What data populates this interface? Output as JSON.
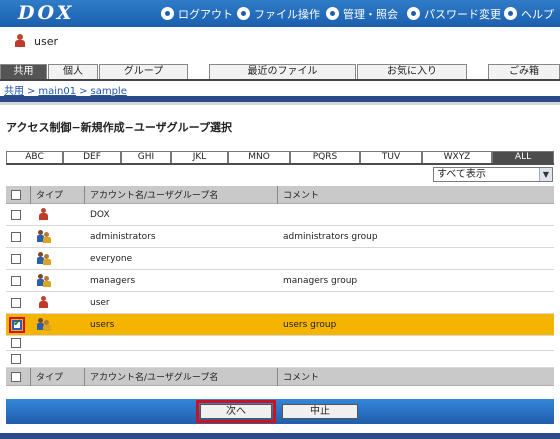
{
  "app": {
    "logo": "DOX"
  },
  "nav": {
    "logout": "ログアウト",
    "file_ops": "ファイル操作",
    "admin": "管理・照会",
    "password": "パスワード変更",
    "help": "ヘルプ"
  },
  "user": {
    "name": "user"
  },
  "tabs": {
    "shared": "共用",
    "personal": "個人",
    "group": "グループ",
    "recent": "最近のファイル",
    "favorites": "お気に入り",
    "trash": "ごみ箱"
  },
  "breadcrumb": [
    "共用",
    "main01",
    "sample"
  ],
  "page_title": "アクセス制御−新規作成−ユーザグループ選択",
  "alpha_tabs": [
    "ABC",
    "DEF",
    "GHI",
    "JKL",
    "MNO",
    "PQRS",
    "TUV",
    "WXYZ",
    "ALL"
  ],
  "filter": {
    "value": "すべて表示"
  },
  "table": {
    "headers": {
      "type": "タイプ",
      "name": "アカウント名/ユーザグループ名",
      "comment": "コメント"
    },
    "rows": [
      {
        "type": "user",
        "name": "DOX",
        "comment": "",
        "checked": false
      },
      {
        "type": "group",
        "name": "administrators",
        "comment": "administrators group",
        "checked": false
      },
      {
        "type": "group",
        "name": "everyone",
        "comment": "",
        "checked": false
      },
      {
        "type": "group",
        "name": "managers",
        "comment": "managers group",
        "checked": false
      },
      {
        "type": "user",
        "name": "user",
        "comment": "",
        "checked": false
      },
      {
        "type": "group",
        "name": "users",
        "comment": "users group",
        "checked": true
      }
    ]
  },
  "buttons": {
    "next": "次へ",
    "cancel": "中止"
  },
  "colors": {
    "topbar": "#1b5fae",
    "selected_row": "#f5b400",
    "highlight": "#d0101a"
  }
}
